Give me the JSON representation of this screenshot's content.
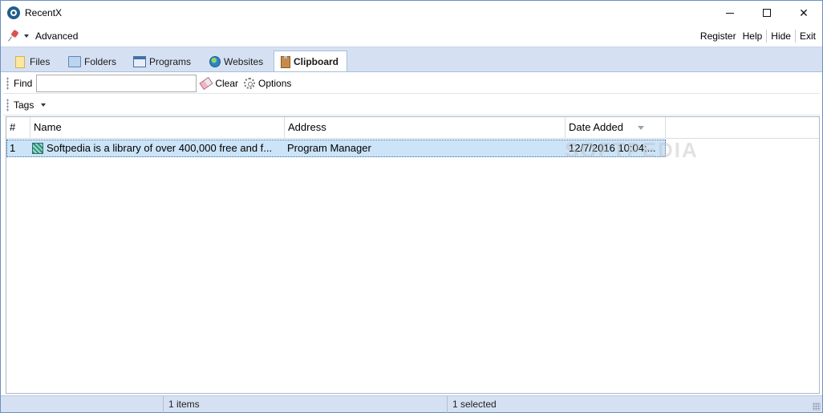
{
  "window": {
    "title": "RecentX"
  },
  "menu": {
    "advanced_label": "Advanced",
    "register_label": "Register",
    "help_label": "Help",
    "hide_label": "Hide",
    "exit_label": "Exit"
  },
  "tabs": [
    {
      "label": "Files",
      "icon": "file-icon"
    },
    {
      "label": "Folders",
      "icon": "folder-icon"
    },
    {
      "label": "Programs",
      "icon": "program-icon"
    },
    {
      "label": "Websites",
      "icon": "globe-icon"
    },
    {
      "label": "Clipboard",
      "icon": "clipboard-icon",
      "active": true
    }
  ],
  "toolbar": {
    "find_label": "Find",
    "find_value": "",
    "clear_label": "Clear",
    "options_label": "Options",
    "tags_label": "Tags"
  },
  "list": {
    "columns": [
      "#",
      "Name",
      "Address",
      "Date Added"
    ],
    "rows": [
      {
        "index": "1",
        "name": "Softpedia is a library of over 400,000 free and f...",
        "address": "Program Manager",
        "date": "12/7/2016 10:04:..."
      }
    ]
  },
  "watermark": "SOFTPEDIA",
  "status": {
    "items": "1 items",
    "selected": "1 selected"
  },
  "colors": {
    "accent": "#d5e1f2",
    "selection": "#cce4f7",
    "border": "#6b8fc2"
  }
}
